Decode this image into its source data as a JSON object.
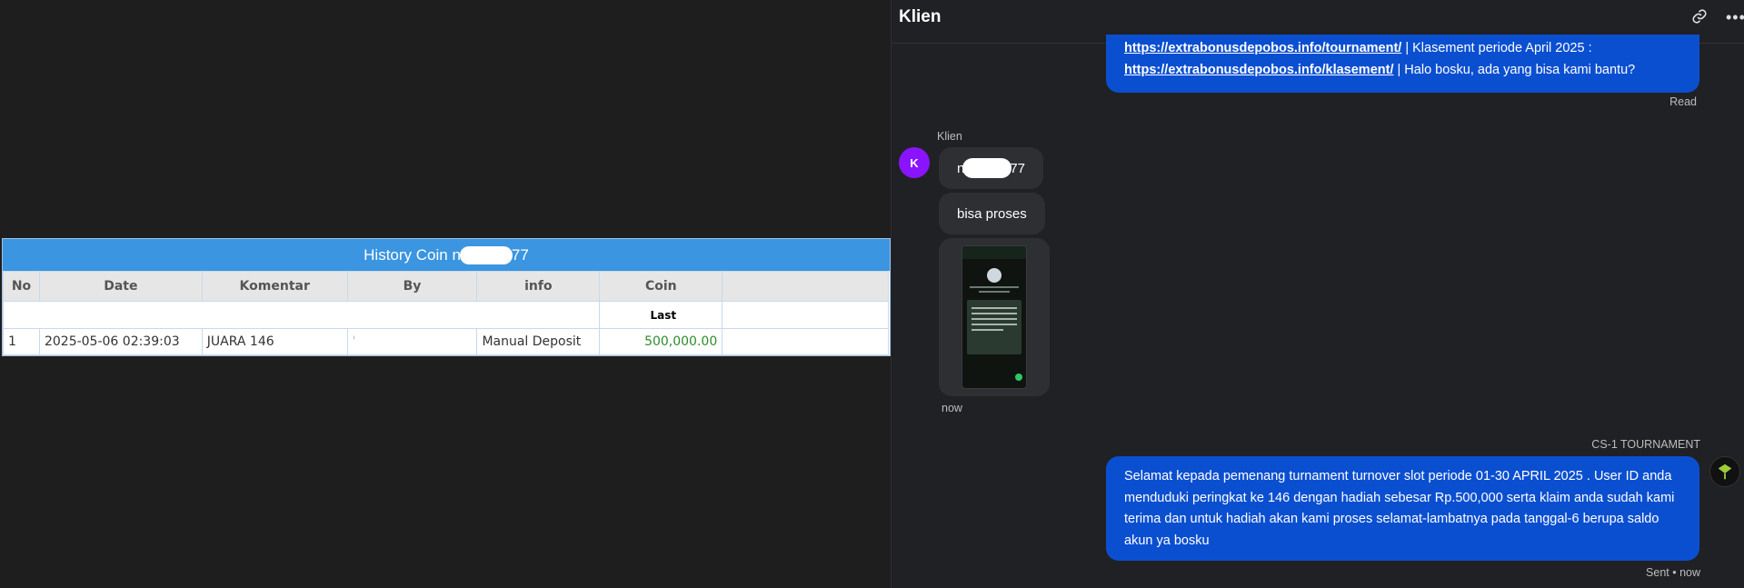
{
  "history": {
    "title_prefix": "History Coin n",
    "title_suffix": "77",
    "columns": [
      "No",
      "Date",
      "Komentar",
      "By",
      "info",
      "Coin"
    ],
    "subheader_last": "Last",
    "rows": [
      {
        "no": "1",
        "date": "2025-05-06 02:39:03",
        "komentar": "JUARA 146",
        "by": "'",
        "info": "Manual Deposit",
        "coin": "500,000.00"
      }
    ]
  },
  "chat": {
    "title": "Klien",
    "top_message": {
      "link1": "https://extrabonusdepobos.info/tournament/",
      "text1": " | Klasement periode April 2025 :",
      "link2": "https://extrabonusdepobos.info/klasement/",
      "text2": " | Halo bosku, ada yang bisa kami bantu?"
    },
    "read_label": "Read",
    "client_name": "Klien",
    "client_avatar_letter": "K",
    "client_msg1_prefix": "n",
    "client_msg1_suffix": "77",
    "client_msg2": "bisa proses",
    "client_time": "now",
    "agent_name": "CS-1 TOURNAMENT",
    "agent_message": "Selamat kepada pemenang turnament turnover slot periode 01-30 APRIL 2025 . User ID anda menduduki peringkat ke 146 dengan hadiah sebesar Rp.500,000 serta klaim anda sudah kami terima dan untuk hadiah akan kami proses selamat-lambatnya pada tanggal-6 berupa saldo akun ya bosku",
    "sent_label": "Sent • now"
  },
  "colors": {
    "table_title_bg": "#3b95e0",
    "agent_bubble": "#0b4fd1",
    "client_bubble": "#2e2f33",
    "avatar_client": "#8a14ff",
    "coin_value": "#2e8b2e"
  },
  "icons": [
    "link-icon",
    "more-icon"
  ]
}
